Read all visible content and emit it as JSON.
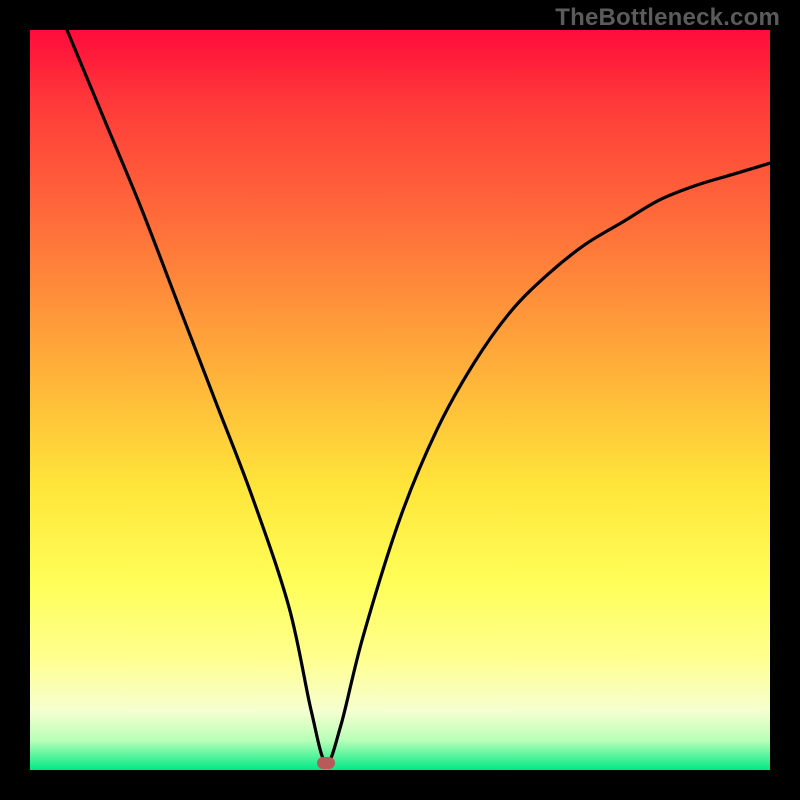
{
  "watermark": "TheBottleneck.com",
  "chart_data": {
    "type": "line",
    "title": "",
    "xlabel": "",
    "ylabel": "",
    "xlim": [
      0,
      100
    ],
    "ylim": [
      0,
      100
    ],
    "grid": false,
    "legend": false,
    "marker": {
      "x": 40,
      "y": 1
    },
    "series": [
      {
        "name": "bottleneck-curve",
        "x": [
          5,
          10,
          15,
          20,
          25,
          30,
          35,
          38,
          40,
          42,
          45,
          50,
          55,
          60,
          65,
          70,
          75,
          80,
          85,
          90,
          95,
          100
        ],
        "y": [
          100,
          88,
          76,
          63,
          50,
          37,
          22,
          8,
          1,
          6,
          18,
          34,
          46,
          55,
          62,
          67,
          71,
          74,
          77,
          79,
          80.5,
          82
        ]
      }
    ],
    "gradient_stops": [
      {
        "pos": 0,
        "color": "#ff0b3b"
      },
      {
        "pos": 10,
        "color": "#ff3a3a"
      },
      {
        "pos": 25,
        "color": "#ff6a3a"
      },
      {
        "pos": 45,
        "color": "#ffad3a"
      },
      {
        "pos": 62,
        "color": "#ffe63a"
      },
      {
        "pos": 75,
        "color": "#ffff5a"
      },
      {
        "pos": 85,
        "color": "#ffff90"
      },
      {
        "pos": 92,
        "color": "#f6ffd0"
      },
      {
        "pos": 96,
        "color": "#b8ffb8"
      },
      {
        "pos": 100,
        "color": "#00e985"
      }
    ]
  }
}
